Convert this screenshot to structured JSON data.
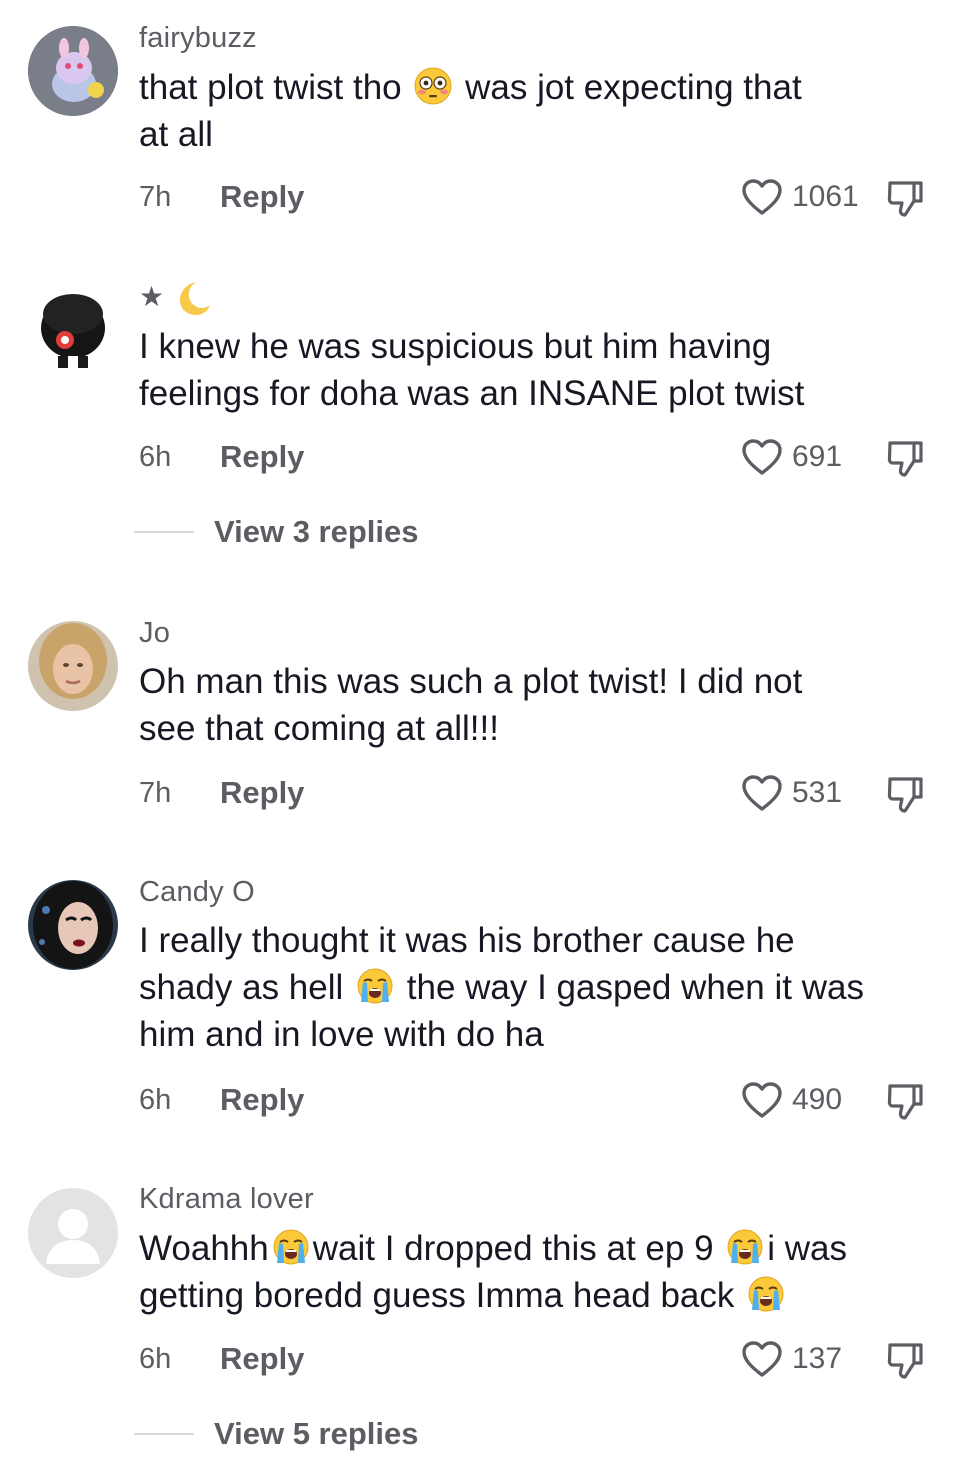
{
  "comments": [
    {
      "username": "fairybuzz",
      "lines": [
        [
          "that plot twist tho ",
          {
            "emoji": "flushed-face"
          },
          " was jot expecting that"
        ],
        [
          "at all"
        ]
      ],
      "time": "7h",
      "reply_label": "Reply",
      "likes": "1061",
      "avatar": "plush-toy-avatar"
    },
    {
      "username": "★🌙",
      "username_parts": [
        "★",
        {
          "emoji": "crescent-moon"
        }
      ],
      "lines": [
        [
          "I knew he was suspicious but him having"
        ],
        [
          "feelings for doha was an INSANE plot twist"
        ]
      ],
      "time": "6h",
      "reply_label": "Reply",
      "likes": "691",
      "view_replies": "View 3 replies",
      "avatar": "black-hair-figure-avatar"
    },
    {
      "username": "Jo",
      "lines": [
        [
          "Oh man this was such a plot twist! I did not"
        ],
        [
          "see that coming at all!!!"
        ]
      ],
      "time": "7h",
      "reply_label": "Reply",
      "likes": "531",
      "avatar": "woman-portrait-avatar"
    },
    {
      "username": "Candy O",
      "lines": [
        [
          "I really thought it was his brother cause he"
        ],
        [
          "shady as hell ",
          {
            "emoji": "loudly-crying-face"
          },
          " the way I gasped when it was"
        ],
        [
          "him and in love with do ha"
        ]
      ],
      "time": "6h",
      "reply_label": "Reply",
      "likes": "490",
      "avatar": "dark-hair-woman-avatar"
    },
    {
      "username": "Kdrama lover",
      "lines": [
        [
          "Woahhh",
          {
            "emoji": "loudly-crying-face"
          },
          "wait I dropped this at ep 9 ",
          {
            "emoji": "loudly-crying-face"
          },
          "i was"
        ],
        [
          "getting boredd guess Imma head back ",
          {
            "emoji": "loudly-crying-face"
          }
        ]
      ],
      "time": "6h",
      "reply_label": "Reply",
      "likes": "137",
      "view_replies": "View 5 replies",
      "avatar": "default-user-avatar"
    }
  ],
  "colors": {
    "text": "#161823",
    "secondary": "#5c5d63",
    "divider": "#d7d8da"
  }
}
